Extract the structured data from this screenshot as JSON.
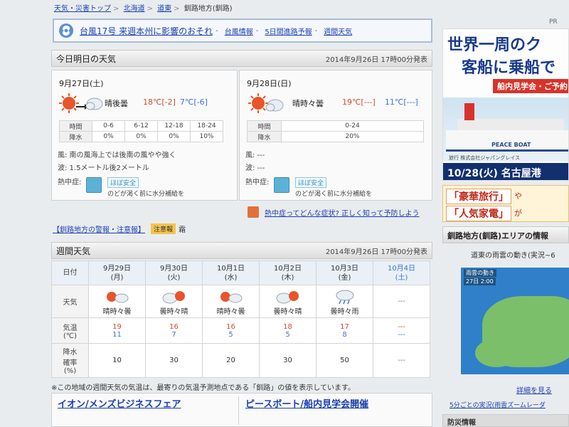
{
  "breadcrumb": {
    "items": [
      "天気・災害トップ",
      "北海道",
      "道東"
    ],
    "current": "釧路地方(釧路)"
  },
  "alert": {
    "main": "台風17号 来週本州に影響のおそれ",
    "links": [
      "台風情報",
      "5日間進路予報",
      "週間天気"
    ]
  },
  "today_section": {
    "title": "今日明日の天気",
    "timestamp": "2014年9月26日 17時00分発表"
  },
  "day1": {
    "date": "9月27日(土)",
    "telop": "晴後曇",
    "high": "18℃",
    "high_diff": "[-2]",
    "low": "7℃",
    "low_diff": "[-6]",
    "table": {
      "time_label": "時間",
      "rain_label": "降水",
      "times": [
        "0-6",
        "6-12",
        "12-18",
        "18-24"
      ],
      "rain": [
        "0%",
        "0%",
        "0%",
        "10%"
      ]
    },
    "wind": "風: 南の風海上では後南の風やや強く",
    "wave": "波: 1.5メートル後2メートル",
    "heat_label": "熱中症:",
    "heat_badge": "ほぼ安全",
    "heat_note": "のどが渇く前に水分補給を"
  },
  "day2": {
    "date": "9月28日(日)",
    "telop": "晴時々曇",
    "high": "19℃",
    "high_diff": "[---]",
    "low": "11℃",
    "low_diff": "[---]",
    "table": {
      "time_label": "時間",
      "rain_label": "降水",
      "times": [
        "0-24"
      ],
      "rain": [
        "20%"
      ]
    },
    "wind": "風: ---",
    "wave": "波: ---",
    "heat_label": "熱中症:",
    "heat_badge": "ほぼ安全",
    "heat_note": "のどが渇く前に水分補給を"
  },
  "heat_link": "熱中症ってどんな症状? 正しく知って予防しよう",
  "warning": {
    "link": "【釧路地方の警報・注意報】",
    "badge": "注意報",
    "word": "霜"
  },
  "week_section": {
    "title": "週間天気",
    "timestamp": "2014年9月26日 17時00分発表"
  },
  "week": {
    "row_labels": {
      "date": "日付",
      "weather": "天気",
      "temp": "気温\n(℃)",
      "precip": "降水\n確率\n(%)"
    },
    "days": [
      {
        "date": "9月29日",
        "dow": "(月)",
        "telop": "晴時々曇",
        "icon": "sun-cloud",
        "high": "19",
        "low": "11",
        "precip": "10"
      },
      {
        "date": "9月30日",
        "dow": "(火)",
        "telop": "曇時々晴",
        "icon": "cloud-sun",
        "high": "16",
        "low": "7",
        "precip": "30"
      },
      {
        "date": "10月1日",
        "dow": "(水)",
        "telop": "晴時々曇",
        "icon": "sun-cloud",
        "high": "16",
        "low": "5",
        "precip": "20"
      },
      {
        "date": "10月2日",
        "dow": "(木)",
        "telop": "曇時々晴",
        "icon": "cloud-sun",
        "high": "18",
        "low": "5",
        "precip": "30"
      },
      {
        "date": "10月3日",
        "dow": "(金)",
        "telop": "曇時々雨",
        "icon": "cloud-rain",
        "high": "17",
        "low": "8",
        "precip": "50"
      },
      {
        "date": "10月4日",
        "dow": "(土)",
        "telop": "---",
        "icon": "none",
        "high": "---",
        "low": "---",
        "precip": "---"
      }
    ]
  },
  "note": "※この地域の週間天気の気温は、最寄りの気温予測地点である「釧路」の値を表示しています。",
  "bottom_links": [
    "イオン/メンズビジネスフェア",
    "ピースボート/船内見学会開催"
  ],
  "sidebar": {
    "pr": "PR",
    "ad1_line1": "世界一周のク",
    "ad1_line2": "客船に乗船で",
    "ad1_tag": "船内見学会・ご予約",
    "ad1_brand": "PEACE BOAT",
    "ad1_small": "旅行 株式会社ジャパングレイス",
    "ad1_bar": "10/28(火) 名古屋港",
    "ad2_a": "「豪華旅行」",
    "ad2_ya": "や",
    "ad2_b": "「人気家電」",
    "ad2_ga": "が",
    "area_head": "釧路地方(釧路)エリアの情報",
    "radar_title": "道東の雨雲の動き(実況~6",
    "radar_label": "雨雲の動き",
    "radar_time": "27日 2:00",
    "detail_link": "詳細を見る",
    "bottom_link": "5分ごとの実況(雨雲ズームレーダ",
    "bottom_head": "防災情報"
  }
}
